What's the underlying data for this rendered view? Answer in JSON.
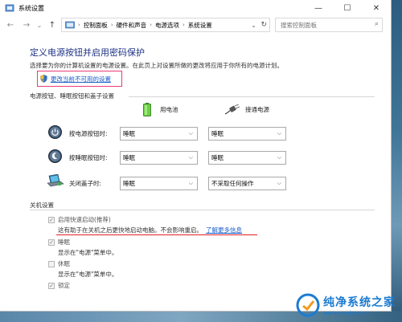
{
  "window": {
    "title": "系统设置",
    "buttons": {
      "minimize": "—",
      "maximize": "☐",
      "close": "✕"
    }
  },
  "nav": {
    "back": "←",
    "forward": "→",
    "recent": "⌄",
    "up": "↑"
  },
  "address": {
    "crumbs": [
      "控制面板",
      "硬件和声音",
      "电源选项",
      "系统设置"
    ],
    "separator": "›"
  },
  "search": {
    "placeholder": "搜索控制面板"
  },
  "page": {
    "title": "定义电源按钮并启用密码保护",
    "description": "选择要为你的计算机设置的电源设置。在此页上对设置所做的更改将应用于你所有的电源计划。",
    "change_link": "更改当前不可用的设置"
  },
  "power_section": {
    "heading": "电源按钮、睡眠按钮和盖子设置",
    "col_battery": "用电池",
    "col_plugged": "接通电源",
    "rows": [
      {
        "label": "按电源按钮时:",
        "battery": "睡眠",
        "plugged": "睡眠"
      },
      {
        "label": "按睡眠按钮时:",
        "battery": "睡眠",
        "plugged": "睡眠"
      },
      {
        "label": "关闭盖子时:",
        "battery": "睡眠",
        "plugged": "不采取任何操作"
      }
    ]
  },
  "shutdown_section": {
    "heading": "关机设置",
    "fast_startup": {
      "label": "启用快速启动(推荐)",
      "checked": true,
      "hint": "这有助于在关机之后更快地启动电脑。不会影响重启。",
      "more": "了解更多信息"
    },
    "sleep": {
      "label": "睡眠",
      "checked": true,
      "hint": "显示在\"电源\"菜单中。"
    },
    "hibernate": {
      "label": "休眠",
      "checked": false,
      "hint": "显示在\"电源\"菜单中。"
    },
    "lock": {
      "label": "锁定",
      "checked": true
    }
  },
  "watermark": {
    "cn": "纯净系统之家",
    "en": "www.ycwjzy.com"
  },
  "colors": {
    "title_blue": "#1e3287",
    "link_blue": "#1a5ec8",
    "highlight_pink": "#e93a7a",
    "underline_red": "#e0202a"
  }
}
